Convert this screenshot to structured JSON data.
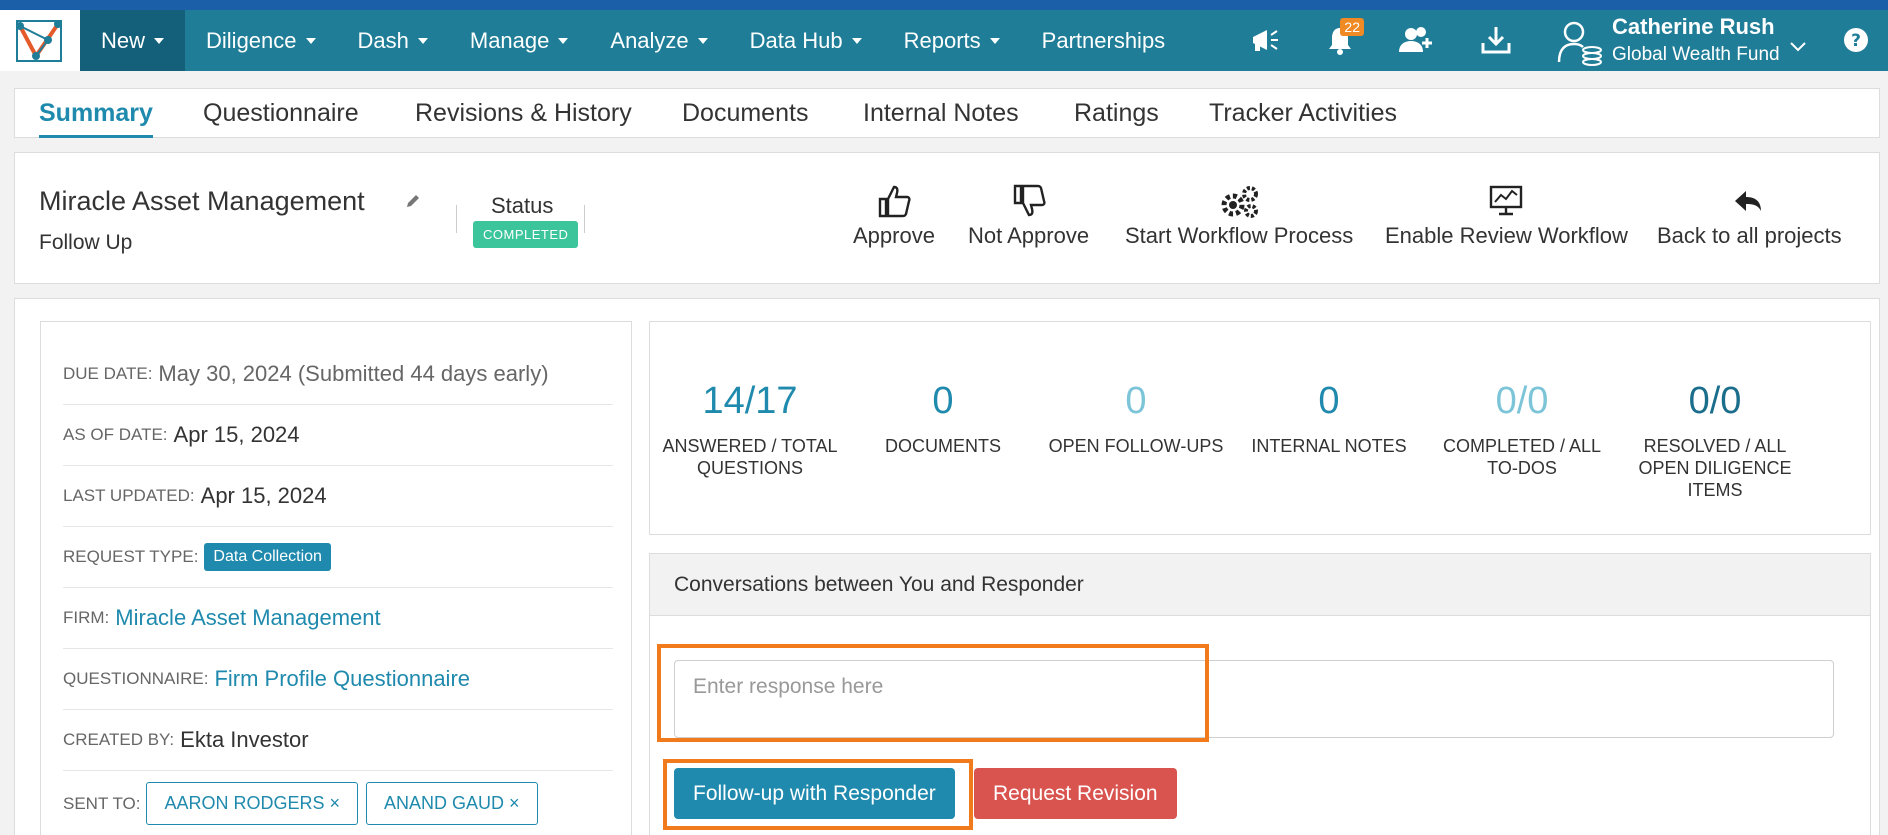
{
  "nav": {
    "items": [
      {
        "label": "New",
        "dropdown": true,
        "active": true
      },
      {
        "label": "Diligence",
        "dropdown": true
      },
      {
        "label": "Dash",
        "dropdown": true
      },
      {
        "label": "Manage",
        "dropdown": true
      },
      {
        "label": "Analyze",
        "dropdown": true
      },
      {
        "label": "Data Hub",
        "dropdown": true
      },
      {
        "label": "Reports",
        "dropdown": true
      },
      {
        "label": "Partnerships",
        "dropdown": false
      }
    ],
    "notification_count": "22",
    "user": {
      "name": "Catherine Rush",
      "org": "Global Wealth Fund"
    },
    "icons": [
      "megaphone-icon",
      "bell-icon",
      "add-user-icon",
      "download-icon",
      "user-money-icon",
      "chevron-down-icon",
      "help-icon"
    ]
  },
  "tabs": [
    "Summary",
    "Questionnaire",
    "Revisions & History",
    "Documents",
    "Internal Notes",
    "Ratings",
    "Tracker Activities"
  ],
  "project": {
    "title": "Miracle Asset Management",
    "subtitle": "Follow Up",
    "status_label": "Status",
    "status_value": "COMPLETED",
    "actions": [
      "Approve",
      "Not Approve",
      "Start Workflow Process",
      "Enable Review Workflow",
      "Back to all projects"
    ]
  },
  "details": {
    "due_date_label": "DUE DATE:",
    "due_date_value": "May 30, 2024 (Submitted 44 days early)",
    "as_of_label": "AS OF DATE:",
    "as_of_value": "Apr 15, 2024",
    "updated_label": "LAST UPDATED:",
    "updated_value": "Apr 15, 2024",
    "request_type_label": "REQUEST TYPE:",
    "request_type_value": "Data Collection",
    "firm_label": "FIRM:",
    "firm_value": "Miracle Asset Management",
    "questionnaire_label": "QUESTIONNAIRE:",
    "questionnaire_value": "Firm Profile Questionnaire",
    "created_label": "CREATED BY:",
    "created_value": "Ekta Investor",
    "sent_label": "SENT TO:",
    "sent_to": [
      "AARON RODGERS ×",
      "ANAND GAUD ×"
    ]
  },
  "stats": [
    {
      "value": "14/17",
      "label": "ANSWERED / TOTAL QUESTIONS"
    },
    {
      "value": "0",
      "label": "DOCUMENTS"
    },
    {
      "value": "0",
      "label": "OPEN FOLLOW-UPS"
    },
    {
      "value": "0",
      "label": "INTERNAL NOTES"
    },
    {
      "value": "0/0",
      "label": "COMPLETED / ALL TO-DOS"
    },
    {
      "value": "0/0",
      "label": "RESOLVED / ALL OPEN DILIGENCE ITEMS"
    }
  ],
  "conversation": {
    "heading": "Conversations between You and Responder",
    "placeholder": "Enter response here",
    "followup_button": "Follow-up with Responder",
    "revision_button": "Request Revision"
  },
  "colors": {
    "nav": "#1f7d97",
    "accent": "#1f8aad",
    "highlight": "#f07a1c",
    "danger": "#d9534f",
    "success": "#3cc49b"
  }
}
